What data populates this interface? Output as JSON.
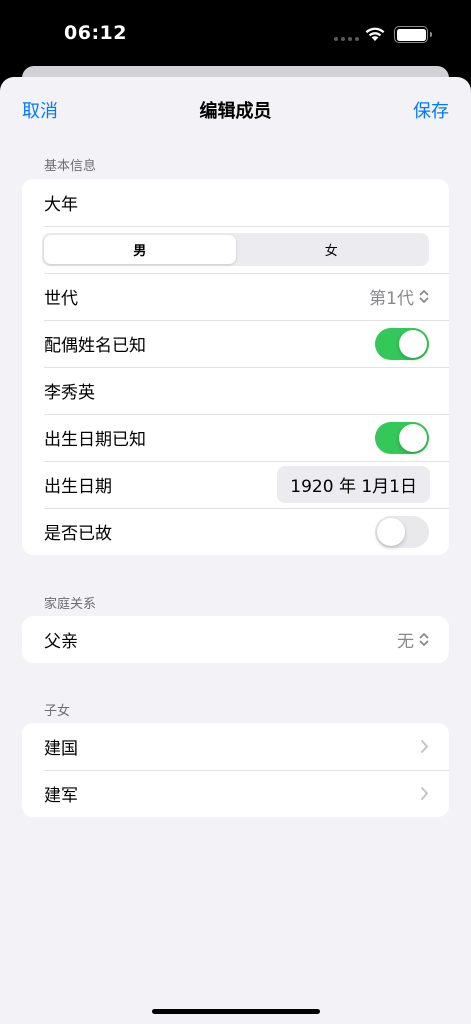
{
  "status": {
    "time": "06:12"
  },
  "nav": {
    "cancel": "取消",
    "title": "编辑成员",
    "save": "保存"
  },
  "basic": {
    "header": "基本信息",
    "name": "大年",
    "gender_options": [
      "男",
      "女"
    ],
    "gender_selected": "男",
    "generation_label": "世代",
    "generation_value": "第1代",
    "spouse_known_label": "配偶姓名已知",
    "spouse_known": true,
    "spouse_name": "李秀英",
    "birth_known_label": "出生日期已知",
    "birth_known": true,
    "birth_date_label": "出生日期",
    "birth_date": "1920 年 1月1日",
    "deceased_label": "是否已故",
    "deceased": false
  },
  "family": {
    "header": "家庭关系",
    "father_label": "父亲",
    "father_value": "无"
  },
  "children": {
    "header": "子女",
    "items": [
      "建国",
      "建军"
    ]
  },
  "colors": {
    "accent": "#007aff",
    "toggle_on": "#34c759",
    "background": "#f2f2f7"
  }
}
